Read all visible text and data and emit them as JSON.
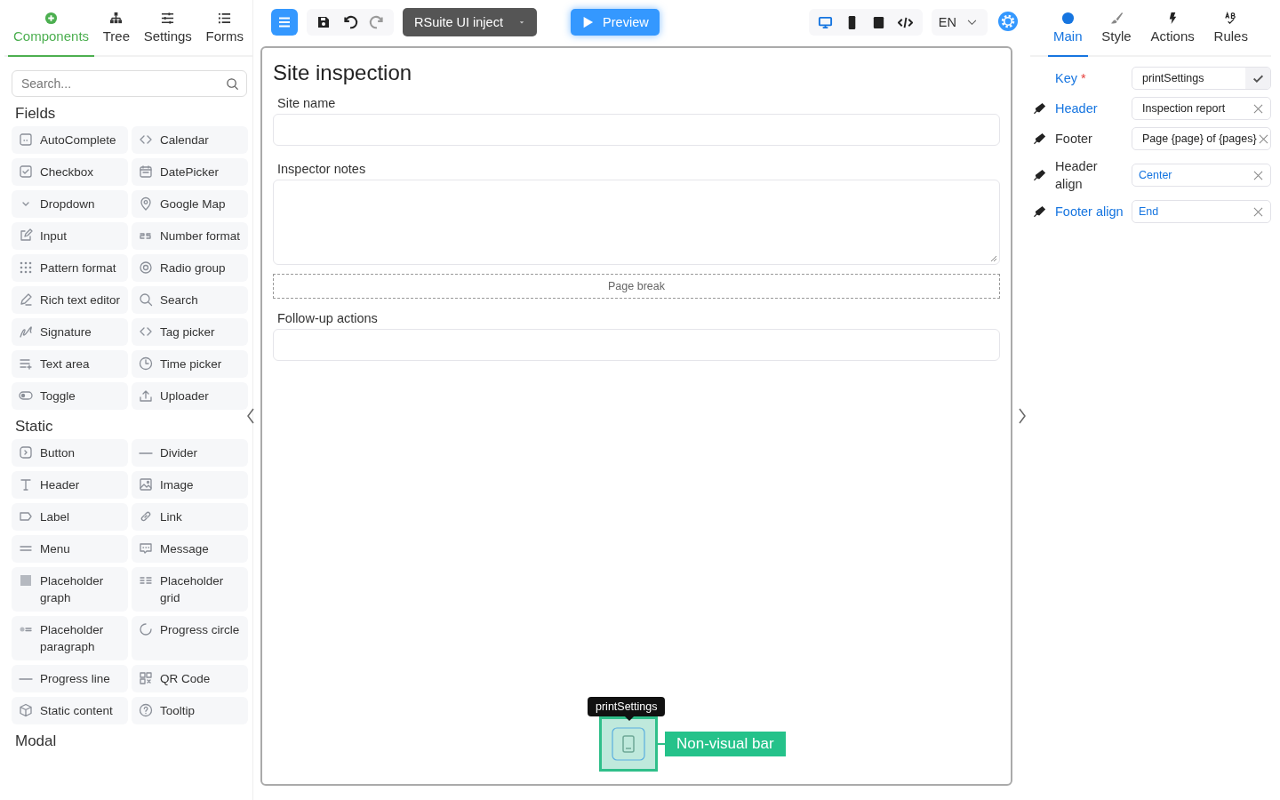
{
  "left_tabs": [
    {
      "label": "Components",
      "selected": true
    },
    {
      "label": "Tree",
      "selected": false
    },
    {
      "label": "Settings",
      "selected": false
    },
    {
      "label": "Forms",
      "selected": false
    }
  ],
  "search": {
    "placeholder": "Search..."
  },
  "sections": [
    {
      "title": "Fields",
      "items": [
        "AutoComplete",
        "Calendar",
        "Checkbox",
        "DatePicker",
        "Dropdown",
        "Google Map",
        "Input",
        "Number format",
        "Pattern format",
        "Radio group",
        "Rich text editor",
        "Search",
        "Signature",
        "Tag picker",
        "Text area",
        "Time picker",
        "Toggle",
        "Uploader"
      ]
    },
    {
      "title": "Static",
      "items": [
        "Button",
        "Divider",
        "Header",
        "Image",
        "Label",
        "Link",
        "Menu",
        "Message",
        "Placeholder graph",
        "Placeholder grid",
        "Placeholder paragraph",
        "Progress circle",
        "Progress line",
        "QR Code",
        "Static content",
        "Tooltip"
      ]
    },
    {
      "title": "Modal"
    }
  ],
  "toolbar": {
    "redo_disabled": true,
    "theme": "RSuite UI inject",
    "preview": "Preview",
    "devices": [
      {
        "kind": "desktop",
        "selected": true
      },
      {
        "kind": "phone",
        "selected": false
      },
      {
        "kind": "tablet",
        "selected": false
      },
      {
        "kind": "code",
        "selected": false
      }
    ],
    "language": "EN"
  },
  "form": {
    "title": "Site inspection",
    "fields": [
      {
        "kind": "input",
        "label": "Site name"
      },
      {
        "kind": "textarea",
        "label": "Inspector notes"
      },
      {
        "kind": "pagebreak",
        "label": "Page break"
      },
      {
        "kind": "input",
        "label": "Follow-up actions"
      }
    ]
  },
  "nonvisual": {
    "tooltip": "printSettings",
    "label": "Non-visual bar"
  },
  "right_tabs": [
    {
      "label": "Main",
      "selected": true
    },
    {
      "label": "Style",
      "selected": false
    },
    {
      "label": "Actions",
      "selected": false
    },
    {
      "label": "Rules",
      "selected": false
    }
  ],
  "properties": [
    {
      "label": "Key",
      "required_mark": "*",
      "highlighted": true,
      "kind": "key",
      "value": "printSettings"
    },
    {
      "label": "Header",
      "highlighted": true,
      "kind": "text",
      "value": "Inspection report"
    },
    {
      "label": "Footer",
      "highlighted": false,
      "kind": "text",
      "value": "Page {page} of {pages}"
    },
    {
      "label": "Header align",
      "highlighted": false,
      "kind": "select",
      "value": "Center"
    },
    {
      "label": "Footer align",
      "highlighted": true,
      "kind": "select",
      "value": "End"
    }
  ]
}
